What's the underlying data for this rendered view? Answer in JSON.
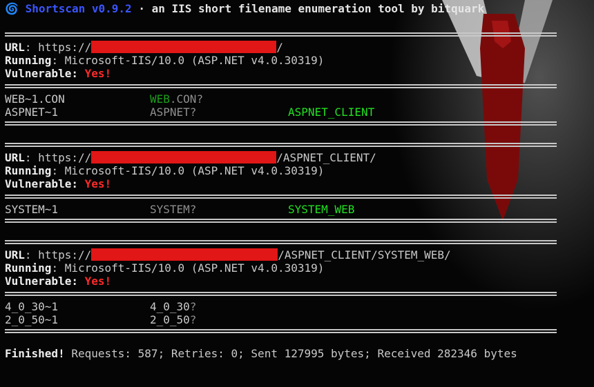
{
  "banner": {
    "spiral": "🌀",
    "app": "Shortscan v0.9.2",
    "tagline": " · an IIS short filename enumeration tool by bitquark"
  },
  "labels": {
    "url": "URL",
    "running": "Running",
    "vulnerable": "Vulnerable",
    "yes": "Yes!",
    "scheme": "https://",
    "server": "Microsoft-IIS/10.0 (ASP.NET v4.0.30319)"
  },
  "scans": [
    {
      "path_suffix": "/",
      "rows": [
        {
          "short": "WEB~1.CON",
          "guess_green": "WEB",
          "guess_rest": ".CON?",
          "full": ""
        },
        {
          "short": "ASPNET~1",
          "guess_green": "",
          "guess_rest": "ASPNET?",
          "full": "ASPNET_CLIENT"
        }
      ]
    },
    {
      "path_suffix": "/ASPNET_CLIENT/",
      "rows": [
        {
          "short": "SYSTEM~1",
          "guess_green": "",
          "guess_rest": "SYSTEM?",
          "full": "SYSTEM_WEB"
        }
      ]
    },
    {
      "path_suffix": "/ASPNET_CLIENT/SYSTEM_WEB/",
      "rows": [
        {
          "short": "4_0_30~1",
          "guess_green": "4_0_30",
          "guess_rest": "?",
          "full": ""
        },
        {
          "short": "2_0_50~1",
          "guess_green": "2_0_50",
          "guess_rest": "?",
          "full": ""
        }
      ]
    }
  ],
  "footer": {
    "finished": "Finished!",
    "stats": " Requests: 587; Retries: 0; Sent 127995 bytes; Received 282346 bytes"
  },
  "colors": {
    "background": "#050505",
    "redaction": "#e11616",
    "found": "#22e022",
    "vulnerable": "#ff2a2a",
    "brand": "#3a55ff"
  }
}
